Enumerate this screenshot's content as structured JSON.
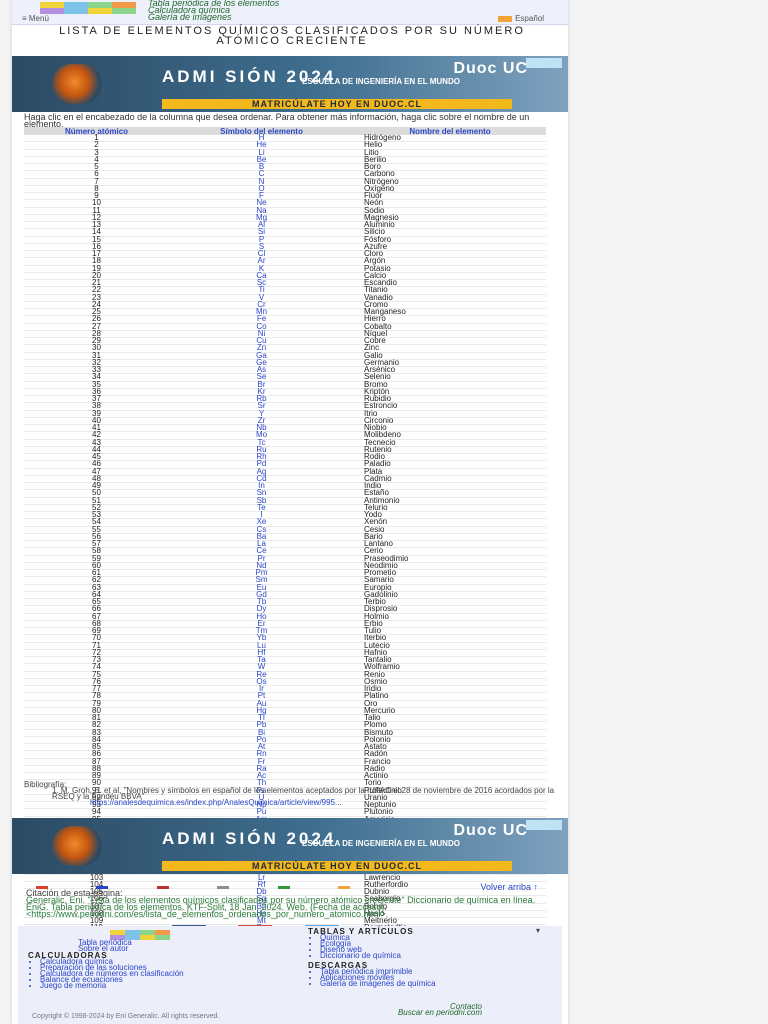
{
  "topbar": {
    "links": [
      "Tabla periódica de los elementos",
      "Calculadora química",
      "Galería de imágenes"
    ],
    "menu_label": "≡ Menú",
    "language_label": "Español"
  },
  "page_title": "LISTA DE ELEMENTOS QUÍMICOS CLASIFICADOS POR SU NÚMERO ATÓMICO CRECIENTE",
  "ad": {
    "brand": "Duoc UC",
    "headline": "ADMI SIÓN 2024",
    "sub": "ESCUELA DE INGENIERÍA EN EL MUNDO",
    "cta": "MATRICÚLATE HOY EN DUOC.CL"
  },
  "intro": "Haga clic en el encabezado de la columna que desea ordenar. Para obtener más información, haga clic sobre el nombre de un elemento.",
  "table": {
    "headers": [
      "Número atómico",
      "Símbolo del elemento",
      "Nombre del elemento"
    ],
    "rows": [
      [
        "1",
        "H",
        "Hidrógeno"
      ],
      [
        "2",
        "He",
        "Helio"
      ],
      [
        "3",
        "Li",
        "Litio"
      ],
      [
        "4",
        "Be",
        "Berilio"
      ],
      [
        "5",
        "B",
        "Boro"
      ],
      [
        "6",
        "C",
        "Carbono"
      ],
      [
        "7",
        "N",
        "Nitrógeno"
      ],
      [
        "8",
        "O",
        "Oxígeno"
      ],
      [
        "9",
        "F",
        "Flúor"
      ],
      [
        "10",
        "Ne",
        "Neón"
      ],
      [
        "11",
        "Na",
        "Sodio"
      ],
      [
        "12",
        "Mg",
        "Magnesio"
      ],
      [
        "13",
        "Al",
        "Aluminio"
      ],
      [
        "14",
        "Si",
        "Silicio"
      ],
      [
        "15",
        "P",
        "Fósforo"
      ],
      [
        "16",
        "S",
        "Azufre"
      ],
      [
        "17",
        "Cl",
        "Cloro"
      ],
      [
        "18",
        "Ar",
        "Argón"
      ],
      [
        "19",
        "K",
        "Potasio"
      ],
      [
        "20",
        "Ca",
        "Calcio"
      ],
      [
        "21",
        "Sc",
        "Escandio"
      ],
      [
        "22",
        "Ti",
        "Titanio"
      ],
      [
        "23",
        "V",
        "Vanadio"
      ],
      [
        "24",
        "Cr",
        "Cromo"
      ],
      [
        "25",
        "Mn",
        "Manganeso"
      ],
      [
        "26",
        "Fe",
        "Hierro"
      ],
      [
        "27",
        "Co",
        "Cobalto"
      ],
      [
        "28",
        "Ni",
        "Níquel"
      ],
      [
        "29",
        "Cu",
        "Cobre"
      ],
      [
        "30",
        "Zn",
        "Zinc"
      ],
      [
        "31",
        "Ga",
        "Galio"
      ],
      [
        "32",
        "Ge",
        "Germanio"
      ],
      [
        "33",
        "As",
        "Arsénico"
      ],
      [
        "34",
        "Se",
        "Selenio"
      ],
      [
        "35",
        "Br",
        "Bromo"
      ],
      [
        "36",
        "Kr",
        "Kriptón"
      ],
      [
        "37",
        "Rb",
        "Rubidio"
      ],
      [
        "38",
        "Sr",
        "Estroncio"
      ],
      [
        "39",
        "Y",
        "Itrio"
      ],
      [
        "40",
        "Zr",
        "Circonio"
      ],
      [
        "41",
        "Nb",
        "Niobio"
      ],
      [
        "42",
        "Mo",
        "Molibdeno"
      ],
      [
        "43",
        "Tc",
        "Tecnecio"
      ],
      [
        "44",
        "Ru",
        "Rutenio"
      ],
      [
        "45",
        "Rh",
        "Rodio"
      ],
      [
        "46",
        "Pd",
        "Paladio"
      ],
      [
        "47",
        "Ag",
        "Plata"
      ],
      [
        "48",
        "Cd",
        "Cadmio"
      ],
      [
        "49",
        "In",
        "Indio"
      ],
      [
        "50",
        "Sn",
        "Estaño"
      ],
      [
        "51",
        "Sb",
        "Antimonio"
      ],
      [
        "52",
        "Te",
        "Telurio"
      ],
      [
        "53",
        "I",
        "Yodo"
      ],
      [
        "54",
        "Xe",
        "Xenón"
      ],
      [
        "55",
        "Cs",
        "Cesio"
      ],
      [
        "56",
        "Ba",
        "Bario"
      ],
      [
        "57",
        "La",
        "Lantano"
      ],
      [
        "58",
        "Ce",
        "Cerio"
      ],
      [
        "59",
        "Pr",
        "Praseodimio"
      ],
      [
        "60",
        "Nd",
        "Neodimio"
      ],
      [
        "61",
        "Pm",
        "Prometio"
      ],
      [
        "62",
        "Sm",
        "Samario"
      ],
      [
        "63",
        "Eu",
        "Europio"
      ],
      [
        "64",
        "Gd",
        "Gadolinio"
      ],
      [
        "65",
        "Tb",
        "Terbio"
      ],
      [
        "66",
        "Dy",
        "Disprosio"
      ],
      [
        "67",
        "Ho",
        "Holmio"
      ],
      [
        "68",
        "Er",
        "Erbio"
      ],
      [
        "69",
        "Tm",
        "Tulio"
      ],
      [
        "70",
        "Yb",
        "Iterbio"
      ],
      [
        "71",
        "Lu",
        "Lutecio"
      ],
      [
        "72",
        "Hf",
        "Hafnio"
      ],
      [
        "73",
        "Ta",
        "Tantalio"
      ],
      [
        "74",
        "W",
        "Wolframio"
      ],
      [
        "75",
        "Re",
        "Renio"
      ],
      [
        "76",
        "Os",
        "Osmio"
      ],
      [
        "77",
        "Ir",
        "Iridio"
      ],
      [
        "78",
        "Pt",
        "Platino"
      ],
      [
        "79",
        "Au",
        "Oro"
      ],
      [
        "80",
        "Hg",
        "Mercurio"
      ],
      [
        "81",
        "Tl",
        "Talio"
      ],
      [
        "82",
        "Pb",
        "Plomo"
      ],
      [
        "83",
        "Bi",
        "Bismuto"
      ],
      [
        "84",
        "Po",
        "Polonio"
      ],
      [
        "85",
        "At",
        "Astato"
      ],
      [
        "86",
        "Rn",
        "Radón"
      ],
      [
        "87",
        "Fr",
        "Francio"
      ],
      [
        "88",
        "Ra",
        "Radio"
      ],
      [
        "89",
        "Ac",
        "Actinio"
      ],
      [
        "90",
        "Th",
        "Torio"
      ],
      [
        "91",
        "Pa",
        "Protactinio"
      ],
      [
        "92",
        "U",
        "Uranio"
      ],
      [
        "93",
        "Np",
        "Neptunio"
      ],
      [
        "94",
        "Pu",
        "Plutonio"
      ],
      [
        "95",
        "Am",
        "Americio"
      ],
      [
        "96",
        "Cm",
        "Curio"
      ],
      [
        "97",
        "Bk",
        "Berkelio"
      ],
      [
        "98",
        "Cf",
        "Californio"
      ],
      [
        "99",
        "Es",
        "Einstenio"
      ],
      [
        "100",
        "Fm",
        "Fermio"
      ],
      [
        "101",
        "Md",
        "Mendelevio"
      ],
      [
        "102",
        "No",
        "Nobelio"
      ],
      [
        "103",
        "Lr",
        "Lawrencio"
      ],
      [
        "104",
        "Rf",
        "Rutherfordio"
      ],
      [
        "105",
        "Db",
        "Dubnio"
      ],
      [
        "106",
        "Sg",
        "Seaborgio"
      ],
      [
        "107",
        "Bh",
        "Bohrio"
      ],
      [
        "108",
        "Hs",
        "Hasio"
      ],
      [
        "109",
        "Mt",
        "Meitnerio"
      ],
      [
        "110",
        "Ds",
        "Darmstadtio"
      ],
      [
        "111",
        "Rg",
        "Roentgenio"
      ],
      [
        "112",
        "Cn",
        "Copernicio"
      ],
      [
        "113",
        "Nh",
        "Nihonio"
      ],
      [
        "114",
        "Fl",
        "Flerovio"
      ],
      [
        "115",
        "Mc",
        "Moscovio"
      ],
      [
        "116",
        "Lv",
        "Livermorio"
      ],
      [
        "117",
        "Ts",
        "Teneso"
      ],
      [
        "118",
        "Og",
        "Oganesón"
      ]
    ]
  },
  "biblio": {
    "heading": "Bibliografía:",
    "ref": "1. M. Groh, S. et al, \"Nombres y símbolos en español de los elementos aceptados por la IUPAC el 28 de noviembre de 2016 acordados por la RSEQ y la Fundéu BBVA\"",
    "url": "https://analesdequimica.es/index.php/AnalesQuimica/article/view/995..."
  },
  "back_to_top": "Volver arriba ↑",
  "citation": {
    "heading": "Citación de esta página:",
    "text": "Generalic, Eni. \"Lista de los elementos químicos clasificados por su número atómico creciente\" Diccionario de química en línea. EniG. Tabla periódica de los elementos. KTF-Split, 18 Jan. 2024. Web. {Fecha de acceso}. <https://www.periodni.com/es/lista_de_elementos_ordenados_por_numero_atomico.html>."
  },
  "footer": {
    "logo_caption": "Tabla periódica",
    "logo_sub": "Sobre el autor",
    "calc_heading": "CALCULADORAS",
    "calc_items": [
      "Calculadora química",
      "Preparación de las soluciones",
      "Calculadora de números en clasificación",
      "Balance de ecuaciones",
      "Juego de memoria"
    ],
    "tables_heading": "TABLAS Y ARTÍCULOS",
    "tables_items": [
      "Química",
      "Ecología",
      "Diseño web",
      "Diccionario de química"
    ],
    "download_heading": "DESCARGAS",
    "download_items": [
      "Tabla periódica imprimible",
      "Aplicaciones móviles",
      "Galería de imágenes de química"
    ],
    "contact": "Contacto",
    "search": "Buscar en periodni.com",
    "copyright": "Copyright © 1998-2024 by Eni Generalic. All rights reserved."
  }
}
